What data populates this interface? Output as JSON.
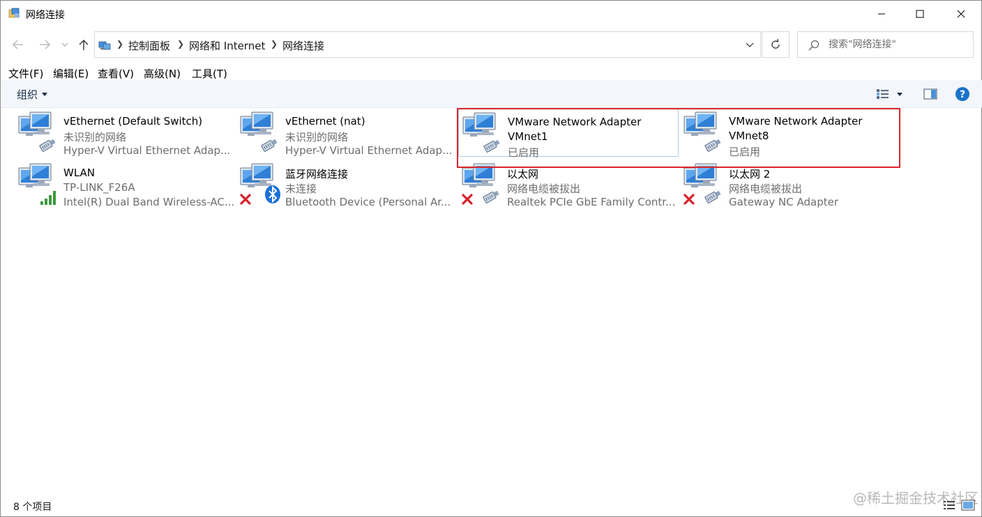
{
  "window": {
    "title": "网络连接",
    "icon": "network-folder-icon"
  },
  "titlebar_buttons": [
    "minimize-icon",
    "maximize-icon",
    "close-icon"
  ],
  "address": {
    "breadcrumbs": [
      "控制面板",
      "网络和 Internet",
      "网络连接"
    ],
    "search_placeholder": "搜索\"网络连接\""
  },
  "menu": {
    "items": [
      "文件(F)",
      "编辑(E)",
      "查看(V)",
      "高级(N)",
      "工具(T)"
    ]
  },
  "toolbar": {
    "organize_label": "组织"
  },
  "connections": [
    {
      "name": "vEthernet (Default Switch)",
      "status": "未识别的网络",
      "device": "Hyper-V Virtual Ethernet Adap...",
      "badge": "cable-icon"
    },
    {
      "name": "vEthernet (nat)",
      "status": "未识别的网络",
      "device": "Hyper-V Virtual Ethernet Adap...",
      "badge": "cable-icon"
    },
    {
      "name": "VMware Network Adapter",
      "name2": "VMnet1",
      "status": "已启用",
      "badge": "cable-icon",
      "selected": true
    },
    {
      "name": "VMware Network Adapter",
      "name2": "VMnet8",
      "status": "已启用",
      "badge": "cable-icon"
    },
    {
      "name": "WLAN",
      "status": "TP-LINK_F26A",
      "device": "Intel(R) Dual Band Wireless-AC...",
      "badge": "wifi-signal-icon"
    },
    {
      "name": "蓝牙网络连接",
      "status": "未连接",
      "device": "Bluetooth Device (Personal Ar...",
      "badge": "bluetooth-icon",
      "error": true
    },
    {
      "name": "以太网",
      "status": "网络电缆被拔出",
      "device": "Realtek PCIe GbE Family Contr...",
      "badge": "cable-icon",
      "error": true
    },
    {
      "name": "以太网 2",
      "status": "网络电缆被拔出",
      "device": "Gateway NC Adapter",
      "badge": "cable-icon",
      "error": true
    }
  ],
  "statusbar": {
    "count_text": "8 个项目"
  },
  "watermark": "@稀土掘金技术社区",
  "colors": {
    "highlight": "#d9262c",
    "selection": "#a8d0ef",
    "help": "#1a73c8"
  }
}
